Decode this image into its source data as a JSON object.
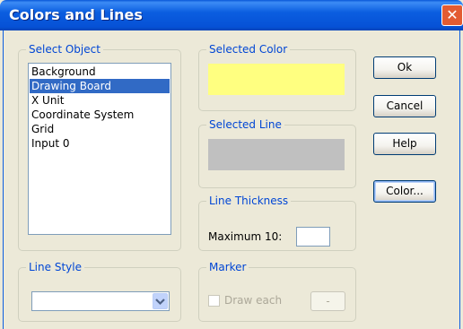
{
  "window": {
    "title": "Colors and Lines",
    "close_glyph": "✕"
  },
  "select_object": {
    "legend": "Select Object",
    "items": [
      {
        "label": "Background",
        "selected": false
      },
      {
        "label": "Drawing Board",
        "selected": true
      },
      {
        "label": "X Unit",
        "selected": false
      },
      {
        "label": "Coordinate System",
        "selected": false
      },
      {
        "label": "Grid",
        "selected": false
      },
      {
        "label": "Input  0",
        "selected": false
      }
    ]
  },
  "selected_color": {
    "legend": "Selected Color",
    "swatch": "#FFFF80"
  },
  "selected_line": {
    "legend": "Selected Line",
    "swatch": "#C0C0C0"
  },
  "line_thickness": {
    "legend": "Line Thickness",
    "label": "Maximum 10:",
    "value": ""
  },
  "line_style": {
    "legend": "Line Style",
    "value": ""
  },
  "marker": {
    "legend": "Marker",
    "checkbox_label": "Draw each",
    "checked": false,
    "button_label": "-"
  },
  "buttons": {
    "ok": "Ok",
    "cancel": "Cancel",
    "help": "Help",
    "color": "Color..."
  },
  "colors": {
    "title_bar": "#0B5EE0",
    "accent": "#0046D5",
    "selection": "#316AC5",
    "close": "#E35B32"
  }
}
